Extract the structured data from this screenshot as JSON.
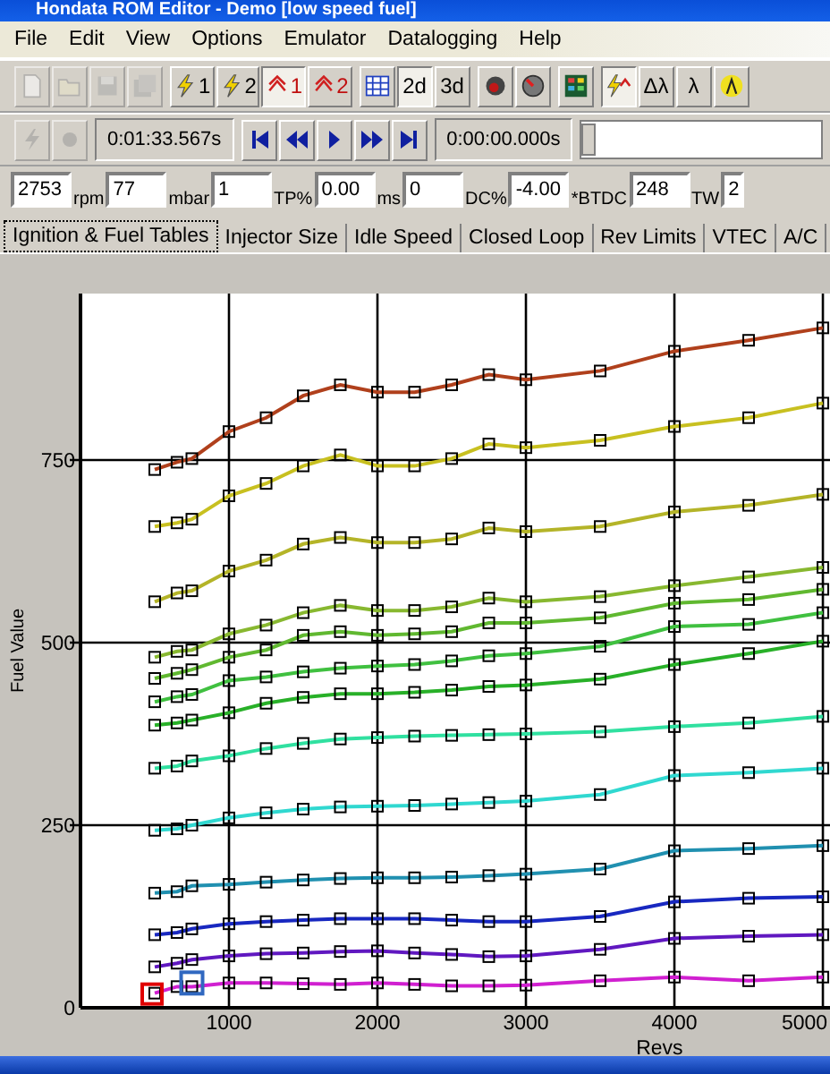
{
  "window": {
    "title": "Hondata ROM Editor - Demo [low speed fuel]"
  },
  "menu": [
    "File",
    "Edit",
    "View",
    "Options",
    "Emulator",
    "Datalogging",
    "Help"
  ],
  "toolbar": [
    [
      {
        "pressed": false,
        "disabled": true
      },
      {
        "pressed": false,
        "disabled": true
      },
      {
        "pressed": false,
        "disabled": true
      },
      {
        "pressed": false,
        "disabled": true
      }
    ],
    [
      {
        "label": "1",
        "pressed": false,
        "disabled": false
      },
      {
        "label": "2",
        "pressed": false,
        "disabled": false
      },
      {
        "label": "1",
        "pressed": true,
        "disabled": false
      },
      {
        "label": "2",
        "pressed": false,
        "disabled": false
      }
    ],
    [
      {
        "pressed": false,
        "disabled": false
      },
      {
        "label": "2d",
        "pressed": true,
        "disabled": false
      },
      {
        "label": "3d",
        "pressed": false,
        "disabled": false
      }
    ],
    [
      {
        "pressed": false,
        "disabled": false
      },
      {
        "pressed": false,
        "disabled": false
      }
    ],
    [
      {
        "pressed": false,
        "disabled": false
      }
    ],
    [
      {
        "pressed": true,
        "disabled": false
      },
      {
        "label": "Δλ",
        "pressed": false,
        "disabled": false
      },
      {
        "label": "λ",
        "pressed": false,
        "disabled": false
      },
      {
        "pressed": false,
        "disabled": false
      }
    ]
  ],
  "playback": {
    "record_buttons": [
      {
        "disabled": true
      },
      {
        "disabled": true
      }
    ],
    "elapsed": "0:01:33.567s",
    "position": "0:00:00.000s",
    "slider": {
      "level": 0.0
    }
  },
  "fields": [
    {
      "value": "2753",
      "unit": "rpm"
    },
    {
      "value": "77",
      "unit": "mbar"
    },
    {
      "value": "1",
      "unit": "TP%"
    },
    {
      "value": "0.00",
      "unit": "ms"
    },
    {
      "value": "0",
      "unit": "DC%"
    },
    {
      "value": "-4.00",
      "unit": "*BTDC"
    },
    {
      "value": "248",
      "unit": "TW"
    },
    {
      "value": "2"
    }
  ],
  "tabs": [
    {
      "label": "Ignition & Fuel Tables",
      "selected": true
    },
    {
      "label": "Injector Size",
      "selected": false
    },
    {
      "label": "Idle Speed",
      "selected": false
    },
    {
      "label": "Closed Loop",
      "selected": false
    },
    {
      "label": "Rev Limits",
      "selected": false
    },
    {
      "label": "VTEC",
      "selected": false
    },
    {
      "label": "A/C",
      "selected": false
    }
  ],
  "chart": {
    "chart_data": {
      "type": "line",
      "xlabel": "Revs",
      "ylabel": "Fuel Value",
      "x": [
        500,
        650,
        750,
        1000,
        1250,
        1500,
        1750,
        2000,
        2250,
        2500,
        2750,
        3000,
        3500,
        4000,
        4500,
        5000
      ],
      "xlim": [
        0,
        5060
      ],
      "ylim": [
        0,
        978
      ],
      "xticks": [
        1000,
        2000,
        3000,
        4000,
        5000
      ],
      "yticks": [
        0,
        250,
        500,
        750
      ],
      "series": [
        {
          "color": "#b0401c",
          "marker": "square",
          "values": [
            737,
            747,
            752,
            789,
            808,
            838,
            853,
            843,
            843,
            853,
            867,
            860,
            872,
            899,
            914,
            931
          ]
        },
        {
          "color": "#c8c020",
          "marker": "square",
          "values": [
            659,
            664,
            669,
            701,
            718,
            742,
            757,
            742,
            742,
            752,
            772,
            767,
            777,
            796,
            808,
            828
          ]
        },
        {
          "color": "#b4b428",
          "marker": "square",
          "values": [
            556,
            568,
            571,
            598,
            613,
            635,
            644,
            637,
            637,
            642,
            657,
            652,
            659,
            679,
            688,
            703
          ]
        },
        {
          "color": "#88b830",
          "marker": "square",
          "values": [
            480,
            488,
            490,
            512,
            524,
            541,
            551,
            544,
            544,
            549,
            561,
            556,
            563,
            578,
            590,
            603
          ]
        },
        {
          "color": "#60b830",
          "marker": "square",
          "values": [
            451,
            458,
            463,
            480,
            490,
            510,
            515,
            510,
            512,
            515,
            527,
            527,
            534,
            554,
            559,
            573
          ]
        },
        {
          "color": "#40c040",
          "marker": "square",
          "values": [
            419,
            426,
            429,
            448,
            453,
            460,
            465,
            468,
            470,
            475,
            482,
            485,
            495,
            522,
            525,
            541
          ]
        },
        {
          "color": "#28b028",
          "marker": "square",
          "values": [
            387,
            390,
            394,
            404,
            417,
            425,
            430,
            430,
            432,
            435,
            440,
            442,
            450,
            470,
            485,
            502
          ]
        },
        {
          "color": "#30e0a0",
          "marker": "square",
          "values": [
            328,
            331,
            338,
            345,
            355,
            362,
            368,
            370,
            372,
            373,
            374,
            375,
            378,
            385,
            390,
            399
          ]
        },
        {
          "color": "#30d8d0",
          "marker": "square",
          "values": [
            243,
            245,
            250,
            260,
            267,
            272,
            275,
            276,
            277,
            279,
            281,
            283,
            292,
            318,
            322,
            328
          ]
        },
        {
          "color": "#2090b0",
          "marker": "square",
          "values": [
            157,
            159,
            167,
            169,
            172,
            175,
            177,
            178,
            178,
            179,
            181,
            183,
            190,
            215,
            218,
            222
          ]
        },
        {
          "color": "#1828c0",
          "marker": "square",
          "values": [
            100,
            103,
            108,
            115,
            118,
            120,
            122,
            122,
            122,
            120,
            118,
            118,
            125,
            145,
            150,
            152
          ]
        },
        {
          "color": "#6018c0",
          "marker": "square",
          "values": [
            56,
            61,
            66,
            71,
            74,
            75,
            77,
            78,
            75,
            73,
            70,
            71,
            80,
            95,
            98,
            100
          ]
        },
        {
          "color": "#d020d0",
          "marker": "square",
          "values": [
            20,
            29,
            29,
            34,
            34,
            33,
            32,
            34,
            32,
            30,
            30,
            31,
            37,
            42,
            37,
            42
          ]
        }
      ],
      "grid": true
    },
    "lines": [
      {
        "selected": false
      },
      {
        "selected": false
      },
      {
        "selected": false
      },
      {
        "selected": false
      },
      {
        "selected": false
      },
      {
        "selected": false
      },
      {
        "selected": false
      },
      {
        "selected": false
      },
      {
        "selected": false
      },
      {
        "selected": false
      },
      {
        "selected": false
      },
      {
        "selected": false
      },
      {
        "selected": true
      }
    ]
  }
}
